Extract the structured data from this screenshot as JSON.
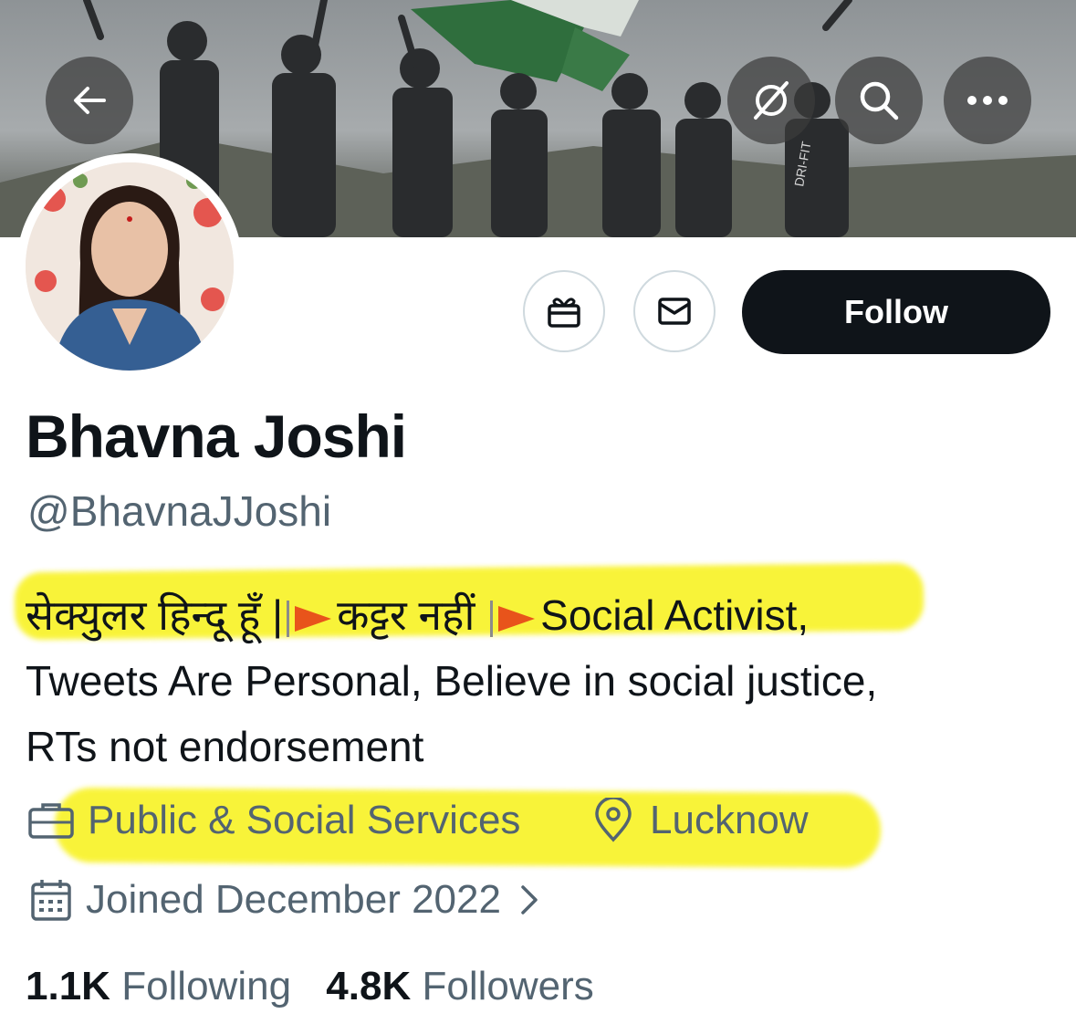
{
  "banner": {
    "back_label": "Back",
    "jersey_text": "DRI-FIT"
  },
  "profile": {
    "name": "Bhavna Joshi",
    "handle": "@BhavnaJJoshi",
    "bio_hindi_1": "सेक्युलर हिन्दू हूँ |",
    "bio_hindi_2": "कट्टर नहीं",
    "bio_english_1": "Social Activist,",
    "bio_line_2": "Tweets Are Personal, Believe in social justice,",
    "bio_line_3": "RTs not endorsement",
    "category": "Public & Social Services",
    "location": "Lucknow",
    "joined": "Joined December 2022"
  },
  "actions": {
    "follow_label": "Follow"
  },
  "stats": {
    "following_count": "1.1K",
    "following_label": "Following",
    "followers_count": "4.8K",
    "followers_label": "Followers"
  },
  "colors": {
    "highlight": "#f8f21e",
    "flag": "#e8541b",
    "text_secondary": "#536471",
    "follow_bg": "#0f1419"
  }
}
